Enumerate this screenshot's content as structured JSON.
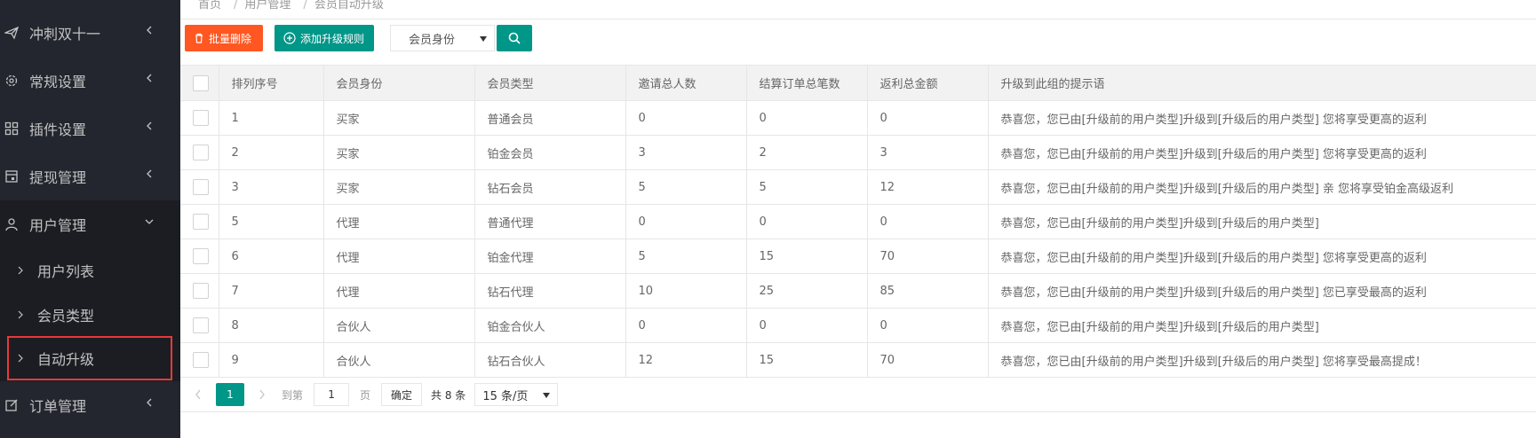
{
  "sidebar": {
    "items": [
      {
        "label": "冲刺双十一",
        "icon": "send-icon"
      },
      {
        "label": "常规设置",
        "icon": "gear-icon"
      },
      {
        "label": "插件设置",
        "icon": "grid-icon"
      },
      {
        "label": "提现管理",
        "icon": "calendar-icon"
      },
      {
        "label": "用户管理",
        "icon": "user-icon"
      },
      {
        "label": "订单管理",
        "icon": "edit-icon"
      }
    ],
    "sub_items": [
      {
        "label": "用户列表"
      },
      {
        "label": "会员类型"
      },
      {
        "label": "自动升级"
      }
    ]
  },
  "breadcrumb": {
    "items": [
      "首页",
      "用户管理",
      "会员自动升级"
    ],
    "separator": "/"
  },
  "toolbar": {
    "batch_delete_label": "批量删除",
    "add_rule_label": "添加升级规则",
    "select_value": "会员身份"
  },
  "table": {
    "headers": [
      "排列序号",
      "会员身份",
      "会员类型",
      "邀请总人数",
      "结算订单总笔数",
      "返利总金额",
      "升级到此组的提示语"
    ],
    "rows": [
      [
        "1",
        "买家",
        "普通会员",
        "0",
        "0",
        "0",
        "恭喜您，您已由[升级前的用户类型]升级到[升级后的用户类型] 您将享受更高的返利"
      ],
      [
        "2",
        "买家",
        "铂金会员",
        "3",
        "2",
        "3",
        "恭喜您，您已由[升级前的用户类型]升级到[升级后的用户类型] 您将享受更高的返利"
      ],
      [
        "3",
        "买家",
        "钻石会员",
        "5",
        "5",
        "12",
        "恭喜您，您已由[升级前的用户类型]升级到[升级后的用户类型] 亲 您将享受铂金高级返利"
      ],
      [
        "5",
        "代理",
        "普通代理",
        "0",
        "0",
        "0",
        "恭喜您，您已由[升级前的用户类型]升级到[升级后的用户类型]"
      ],
      [
        "6",
        "代理",
        "铂金代理",
        "5",
        "15",
        "70",
        "恭喜您，您已由[升级前的用户类型]升级到[升级后的用户类型] 您将享受更高的返利"
      ],
      [
        "7",
        "代理",
        "钻石代理",
        "10",
        "25",
        "85",
        "恭喜您，您已由[升级前的用户类型]升级到[升级后的用户类型] 您已享受最高的返利"
      ],
      [
        "8",
        "合伙人",
        "铂金合伙人",
        "0",
        "0",
        "0",
        "恭喜您，您已由[升级前的用户类型]升级到[升级后的用户类型]"
      ],
      [
        "9",
        "合伙人",
        "钻石合伙人",
        "12",
        "15",
        "70",
        "恭喜您，您已由[升级前的用户类型]升级到[升级后的用户类型] 您将享受最高提成！"
      ]
    ]
  },
  "pager": {
    "current": "1",
    "goto_label": "到第",
    "goto_value": "1",
    "page_unit": "页",
    "confirm_label": "确定",
    "total_label": "共 8 条",
    "page_size": "15 条/页"
  },
  "colors": {
    "sidebar_bg": "#23262e",
    "danger": "#ff5722",
    "primary": "#009688",
    "active_outline": "#e53a3a"
  }
}
